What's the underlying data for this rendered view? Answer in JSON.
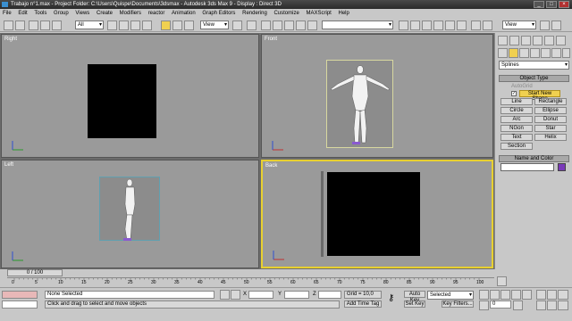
{
  "window": {
    "title": "Trabajo n°1.max    - Project Folder: C:\\Users\\Quispe\\Documents\\3dsmax    - Autodesk 3ds Max 9    - Display : Direct 3D"
  },
  "menu": [
    "File",
    "Edit",
    "Tools",
    "Group",
    "Views",
    "Create",
    "Modifiers",
    "reactor",
    "Animation",
    "Graph Editors",
    "Rendering",
    "Customize",
    "MAXScript",
    "Help"
  ],
  "toolbar": {
    "selection_filter": "All",
    "ref_coord": "View",
    "named_sel_placeholder": "",
    "view_right": "View"
  },
  "viewports": {
    "top_left": "Right",
    "top_right": "Front",
    "bottom_left": "Left",
    "bottom_right": "Back"
  },
  "command_panel": {
    "category": "Splines",
    "object_type_header": "Object Type",
    "autogrid": "AutoGrid",
    "start_new_shape": "Start New Shape",
    "buttons": [
      "Line",
      "Rectangle",
      "Circle",
      "Ellipse",
      "Arc",
      "Donut",
      "NGon",
      "Star",
      "Text",
      "Helix",
      "Section"
    ],
    "name_color_header": "Name and Color",
    "color": "#7a3ab8"
  },
  "timeline": {
    "slider": "0 / 100",
    "ticks": [
      "0",
      "5",
      "10",
      "15",
      "20",
      "25",
      "30",
      "35",
      "40",
      "45",
      "50",
      "55",
      "60",
      "65",
      "70",
      "75",
      "80",
      "85",
      "90",
      "95",
      "100"
    ]
  },
  "status": {
    "selection": "None Selected",
    "prompt": "Click and drag to select and move objects",
    "x_label": "X",
    "y_label": "Y",
    "z_label": "Z",
    "grid": "Grid = 10,0",
    "add_time_tag": "Add Time Tag",
    "auto_key": "Auto Key",
    "set_key": "Set Key",
    "selected_dd": "Selected",
    "key_filters": "Key Filters...",
    "frame": "0"
  },
  "colors": {
    "accent": "#e8d030",
    "viewport_bg": "#9a9a9a"
  }
}
